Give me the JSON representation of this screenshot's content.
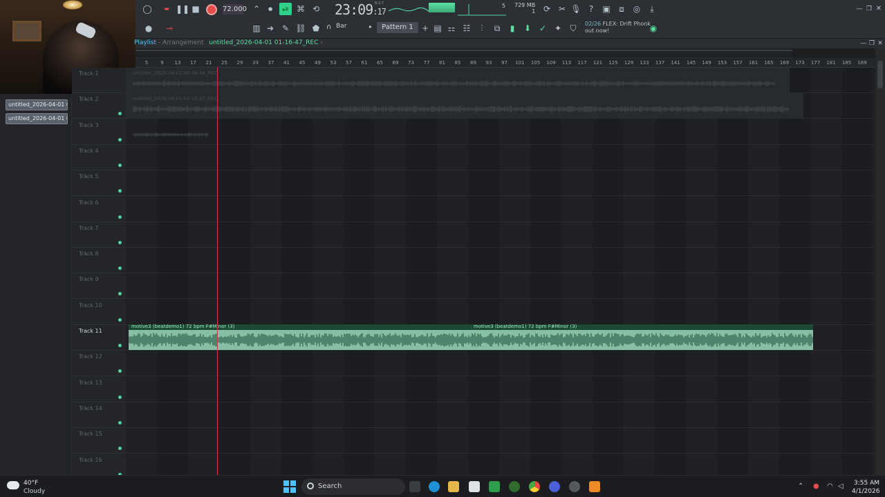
{
  "toolbar": {
    "tempo": "72.000",
    "time_main": "23:09",
    "time_sub": "17",
    "time_label": "B:S:T",
    "cpu_mem": "729 MB",
    "cpu_line2": "1",
    "cpu_value": "5",
    "snap": "Bar",
    "pattern": "Pattern 1",
    "news_date": "02/26",
    "news_text": "FLEX: Drift Phonk",
    "news_text2": "out now!"
  },
  "playlist": {
    "title": "Playlist",
    "separator": " - ",
    "mode": "Arrangement",
    "file": "untitled_2026-04-01 01-16-47_REC"
  },
  "browser": {
    "items": [
      "untitled_2026-04-01 01-...",
      "untitled_2026-04-01 02-..."
    ]
  },
  "ruler": [
    "5",
    "9",
    "13",
    "17",
    "21",
    "25",
    "29",
    "33",
    "37",
    "41",
    "45",
    "49",
    "53",
    "57",
    "61",
    "65",
    "69",
    "73",
    "77",
    "81",
    "85",
    "89",
    "93",
    "97",
    "101",
    "105",
    "109",
    "113",
    "117",
    "121",
    "125",
    "129",
    "133",
    "137",
    "141",
    "145",
    "149",
    "153",
    "157",
    "161",
    "165",
    "169",
    "173",
    "177",
    "181",
    "185",
    "189"
  ],
  "tracks": [
    "Track 1",
    "Track 2",
    "Track 3",
    "Track 4",
    "Track 5",
    "Track 6",
    "Track 7",
    "Track 8",
    "Track 9",
    "Track 10",
    "Track 11",
    "Track 12",
    "Track 13",
    "Track 14",
    "Track 15",
    "Track 16"
  ],
  "clips": {
    "rec1": "untitled_2026-04-01 00-34-44_REC",
    "rec2": "untitled_2026-04-01 01-16-47_REC",
    "motive_a": "motive3 (beatdemo1) 72 bpm F#Minor (3)",
    "motive_b": "motive3 (beatdemo1) 72 bpm F#Minor (3)"
  },
  "taskbar": {
    "temp": "40°F",
    "condition": "Cloudy",
    "search": "Search",
    "time": "3:55 AM",
    "date": "4/1/2026"
  },
  "colors": {
    "accent": "#5be0a0",
    "clip": "#86bfa4",
    "playhead": "#c83c3c",
    "record": "#e84b4b"
  }
}
